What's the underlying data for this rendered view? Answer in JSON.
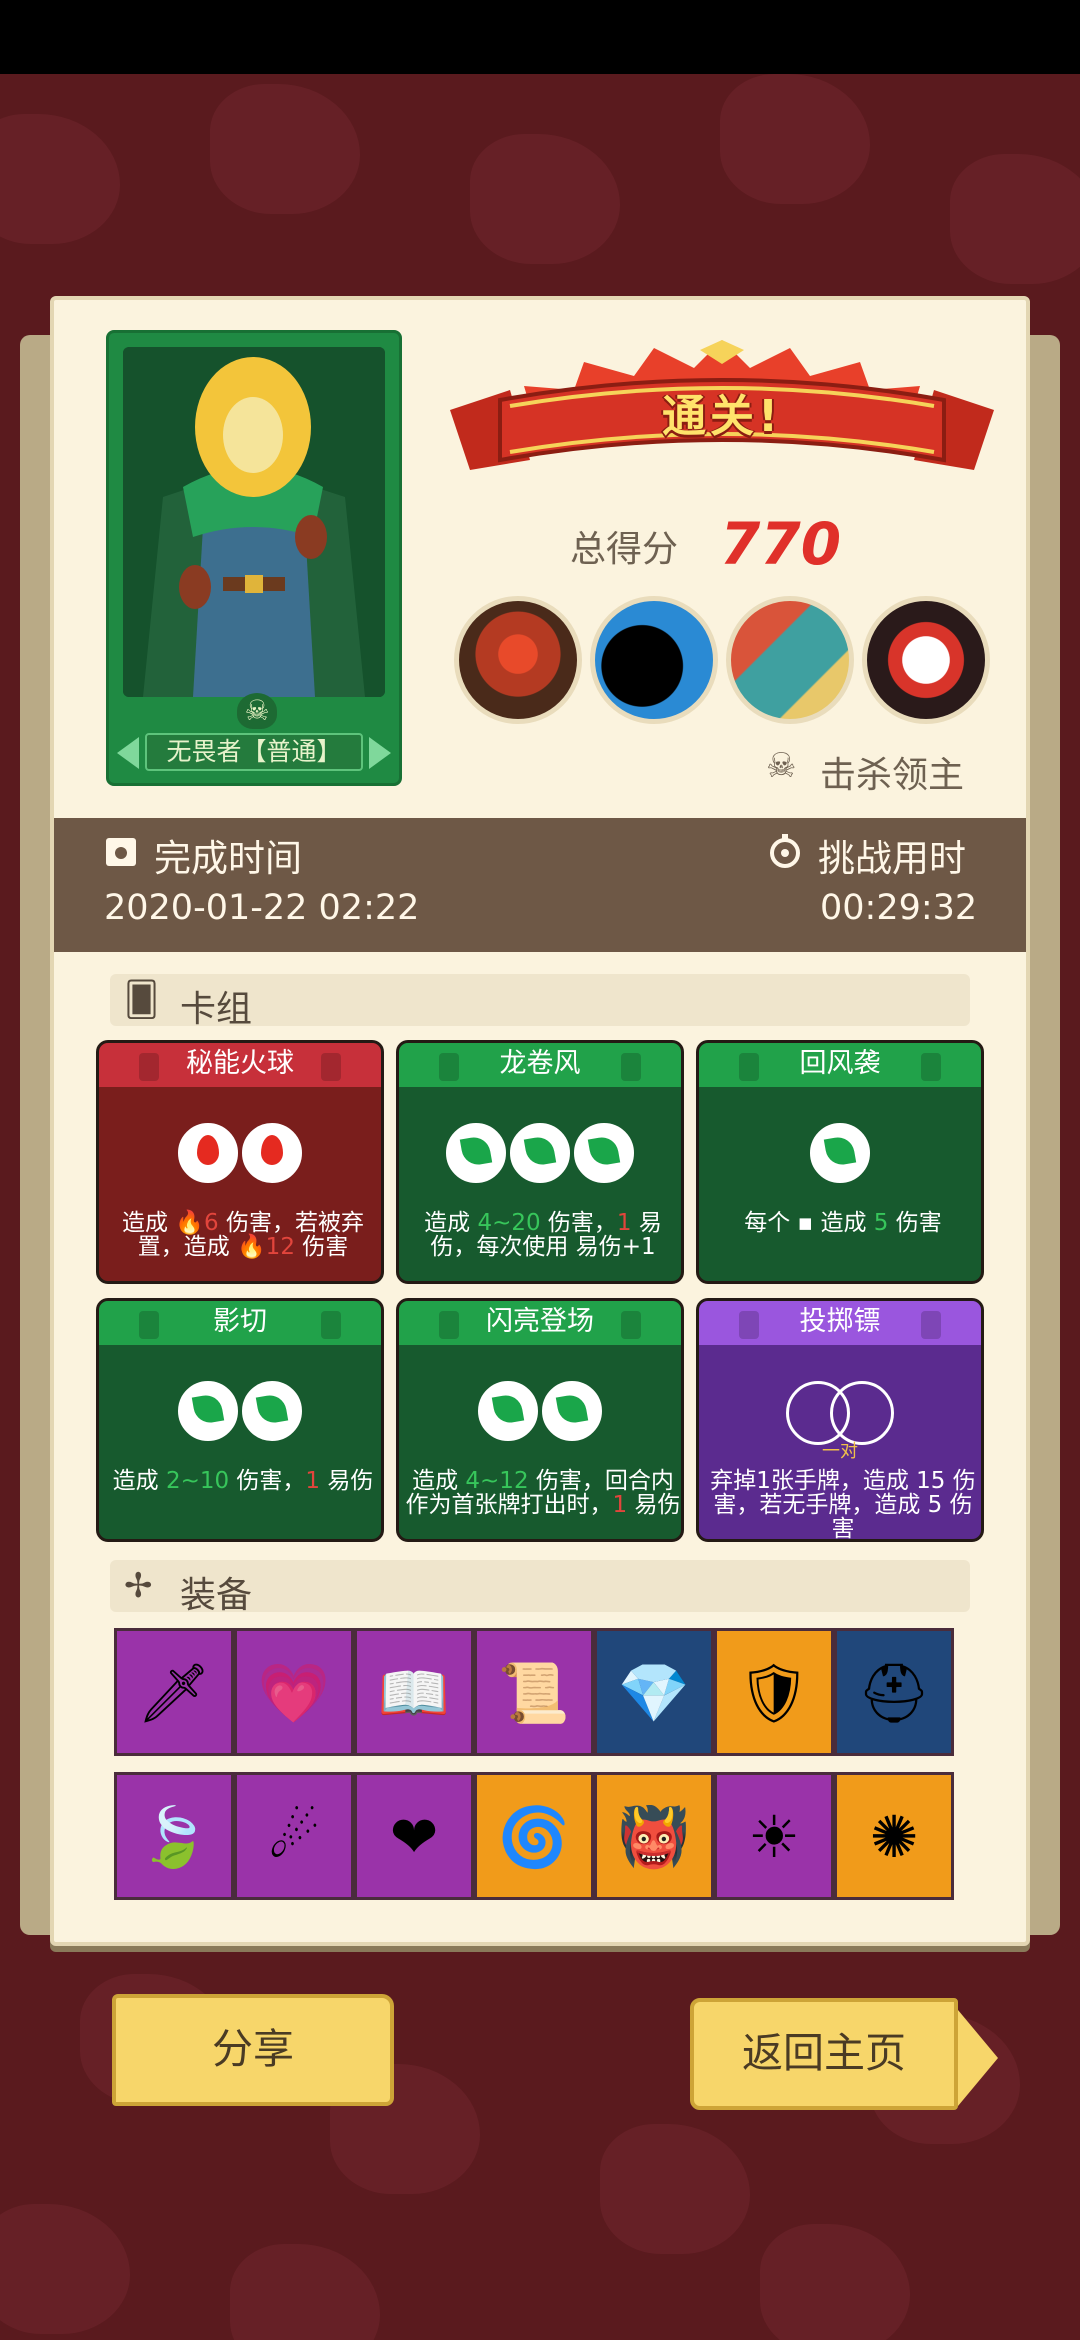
{
  "hero": {
    "name": "无畏者【普通】"
  },
  "banner": {
    "text": "通关!"
  },
  "score": {
    "label": "总得分",
    "value": "770"
  },
  "bosses": [
    {
      "name": "red-eye-monster-boss"
    },
    {
      "name": "shadow-beast-boss"
    },
    {
      "name": "fish-man-boss"
    },
    {
      "name": "mask-demon-boss"
    }
  ],
  "kill_label": "击杀领主",
  "finish": {
    "label": "完成时间",
    "value": "2020-01-22 02:22"
  },
  "duration": {
    "label": "挑战用时",
    "value": "00:29:32"
  },
  "deck_title": "卡组",
  "cards": [
    {
      "title": "秘能火球",
      "color": "red",
      "costs": [
        "fire",
        "fire"
      ],
      "desc": [
        {
          "t": "造成 "
        },
        {
          "t": "🔥6",
          "c": "r"
        },
        {
          "t": " 伤害，若被弃置，造成 "
        },
        {
          "t": "🔥12",
          "c": "r"
        },
        {
          "t": " 伤害"
        }
      ]
    },
    {
      "title": "龙卷风",
      "color": "green",
      "costs": [
        "leaf",
        "leaf",
        "leaf"
      ],
      "desc": [
        {
          "t": "造成 "
        },
        {
          "t": "4~20",
          "c": "g"
        },
        {
          "t": " 伤害，"
        },
        {
          "t": "1",
          "c": "r"
        },
        {
          "t": " 易伤，每次使用 "
        },
        {
          "t": "易伤+1"
        }
      ]
    },
    {
      "title": "回风袭",
      "color": "green",
      "costs": [
        "leaf"
      ],
      "desc": [
        {
          "t": "每个 ▪ 造成 "
        },
        {
          "t": "5",
          "c": "g"
        },
        {
          "t": " 伤害"
        }
      ]
    },
    {
      "title": "影切",
      "color": "green",
      "costs": [
        "leaf",
        "leaf"
      ],
      "desc": [
        {
          "t": "造成 "
        },
        {
          "t": "2~10",
          "c": "g"
        },
        {
          "t": " 伤害，"
        },
        {
          "t": "1",
          "c": "r"
        },
        {
          "t": " 易伤"
        }
      ]
    },
    {
      "title": "闪亮登场",
      "color": "green",
      "costs": [
        "leaf",
        "leaf"
      ],
      "desc": [
        {
          "t": "造成 "
        },
        {
          "t": "4~12",
          "c": "g"
        },
        {
          "t": " 伤害，回合内作为首张牌打出时，"
        },
        {
          "t": "1",
          "c": "r"
        },
        {
          "t": " 易伤"
        }
      ]
    },
    {
      "title": "投掷镖",
      "color": "purple",
      "costs": [
        "empty",
        "empty"
      ],
      "pair": "一对",
      "desc": [
        {
          "t": "弃掉1张手牌，造成 15 伤害，若无手牌，造成 5 伤害"
        }
      ]
    }
  ],
  "equip_title": "装备",
  "equipment_row1": [
    {
      "name": "dagger-icon",
      "bg": "purple",
      "glyph": "🗡"
    },
    {
      "name": "heart-necklace-icon",
      "bg": "purple",
      "glyph": "💗"
    },
    {
      "name": "spellbook-icon",
      "bg": "purple",
      "glyph": "📖"
    },
    {
      "name": "scroll-icon",
      "bg": "purple",
      "glyph": "📜"
    },
    {
      "name": "crystal-boot-icon",
      "bg": "navy",
      "glyph": "💎"
    },
    {
      "name": "ice-shield-icon",
      "bg": "orange",
      "glyph": "🛡"
    },
    {
      "name": "golden-helmet-icon",
      "bg": "navy",
      "glyph": "⛑"
    }
  ],
  "equipment_row2": [
    {
      "name": "green-leaf-icon",
      "bg": "purple",
      "glyph": "🍃"
    },
    {
      "name": "shadow-orb-icon",
      "bg": "purple",
      "glyph": "☄"
    },
    {
      "name": "heart-charm-icon",
      "bg": "purple",
      "glyph": "❤"
    },
    {
      "name": "wind-scroll-icon",
      "bg": "orange",
      "glyph": "🌀"
    },
    {
      "name": "demon-armor-icon",
      "bg": "orange",
      "glyph": "👹"
    },
    {
      "name": "sun-totem-icon",
      "bg": "purple",
      "glyph": "☀"
    },
    {
      "name": "spiked-orb-icon",
      "bg": "orange",
      "glyph": "✺"
    }
  ],
  "buttons": {
    "share": "分享",
    "home": "返回主页"
  },
  "colors": {
    "accent_red": "#e0302a",
    "panel": "#fbf3de",
    "strip": "#6e5846"
  }
}
